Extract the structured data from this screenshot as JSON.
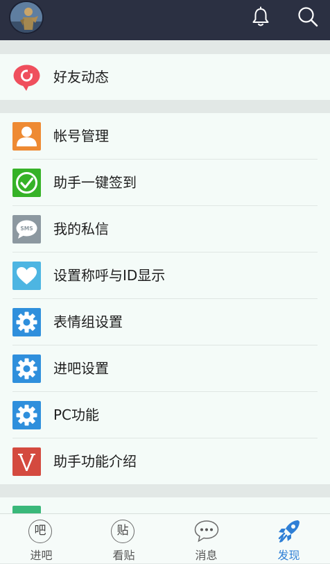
{
  "header": {
    "avatar_icon": "user-avatar",
    "bell_icon": "bell-icon",
    "search_icon": "search-icon"
  },
  "section1": {
    "items": [
      {
        "label": "好友动态",
        "icon": "friend-feed-icon",
        "color": "#ef4f5d"
      }
    ]
  },
  "section2": {
    "items": [
      {
        "label": "帐号管理",
        "icon": "account-icon",
        "color": "#ee8a33"
      },
      {
        "label": "助手一键签到",
        "icon": "checkin-icon",
        "color": "#36b227"
      },
      {
        "label": "我的私信",
        "icon": "sms-icon",
        "color": "#8c98a0"
      },
      {
        "label": "设置称呼与ID显示",
        "icon": "heart-icon",
        "color": "#4db5e2"
      },
      {
        "label": "表情组设置",
        "icon": "gear-icon",
        "color": "#2f8fdc"
      },
      {
        "label": "进吧设置",
        "icon": "gear-icon",
        "color": "#2f8fdc"
      },
      {
        "label": "PC功能",
        "icon": "gear-icon",
        "color": "#2f8fdc"
      },
      {
        "label": "助手功能介绍",
        "icon": "v-icon",
        "color": "#d44a3f"
      }
    ]
  },
  "tabbar": {
    "tabs": [
      {
        "label": "进吧",
        "glyph": "吧"
      },
      {
        "label": "看贴",
        "glyph": "贴"
      },
      {
        "label": "消息",
        "glyph": "···"
      },
      {
        "label": "发现",
        "glyph": ""
      }
    ],
    "active_color": "#2f7fd6"
  }
}
